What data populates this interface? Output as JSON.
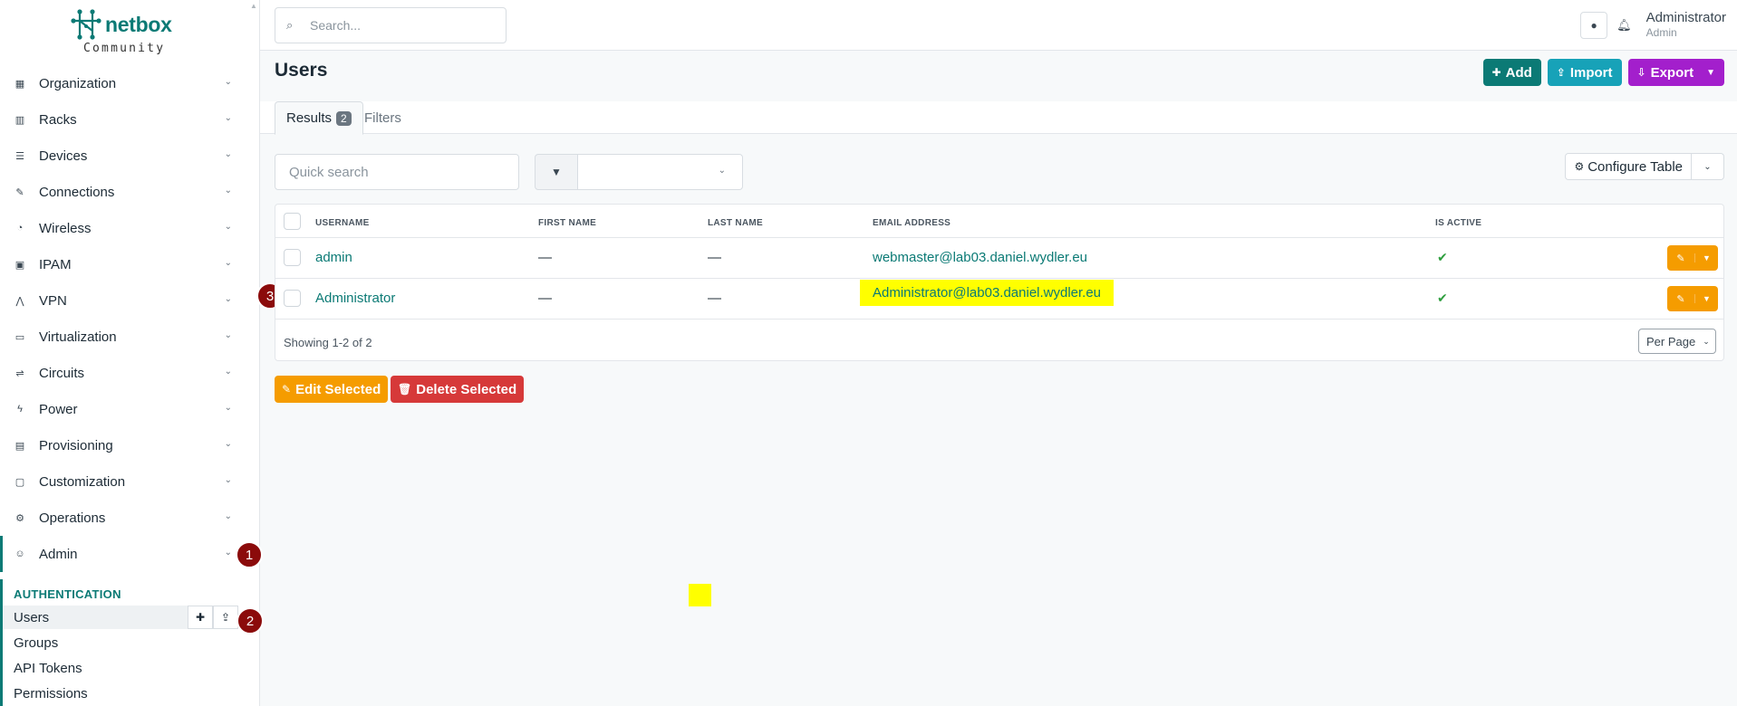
{
  "brand": {
    "name": "netbox",
    "edition": "Community"
  },
  "sidebar": {
    "menu": [
      {
        "label": "Organization",
        "icon": "building-icon",
        "glyph": "▦"
      },
      {
        "label": "Racks",
        "icon": "rack-icon",
        "glyph": "▥"
      },
      {
        "label": "Devices",
        "icon": "server-icon",
        "glyph": "☰"
      },
      {
        "label": "Connections",
        "icon": "plug-icon",
        "glyph": "✎"
      },
      {
        "label": "Wireless",
        "icon": "wifi-icon",
        "glyph": "◔"
      },
      {
        "label": "IPAM",
        "icon": "ipam-icon",
        "glyph": "▣"
      },
      {
        "label": "VPN",
        "icon": "vpn-icon",
        "glyph": "⋀"
      },
      {
        "label": "Virtualization",
        "icon": "monitor-icon",
        "glyph": "▭"
      },
      {
        "label": "Circuits",
        "icon": "circuit-icon",
        "glyph": "⇌"
      },
      {
        "label": "Power",
        "icon": "lightning-icon",
        "glyph": "ϟ"
      },
      {
        "label": "Provisioning",
        "icon": "document-icon",
        "glyph": "▤"
      },
      {
        "label": "Customization",
        "icon": "toolbox-icon",
        "glyph": "▢"
      },
      {
        "label": "Operations",
        "icon": "cogs-icon",
        "glyph": "⚙"
      },
      {
        "label": "Admin",
        "icon": "users-icon",
        "glyph": "☺"
      }
    ],
    "section_title": "AUTHENTICATION",
    "sub_items": [
      "Users",
      "Groups",
      "API Tokens",
      "Permissions"
    ]
  },
  "topbar": {
    "search_placeholder": "Search...",
    "user_name": "Administrator",
    "user_role": "Admin"
  },
  "page": {
    "title": "Users",
    "actions": {
      "add": "Add",
      "import": "Import",
      "export": "Export"
    },
    "tabs": {
      "results": "Results",
      "results_count": "2",
      "filters": "Filters"
    },
    "quick_search_placeholder": "Quick search",
    "configure_table": "Configure Table"
  },
  "table": {
    "columns": [
      "USERNAME",
      "FIRST NAME",
      "LAST NAME",
      "EMAIL ADDRESS",
      "IS ACTIVE"
    ],
    "rows": [
      {
        "username": "admin",
        "first_name": "—",
        "last_name": "—",
        "email": "webmaster@lab03.daniel.wydler.eu",
        "is_active": "✔"
      },
      {
        "username": "Administrator",
        "first_name": "—",
        "last_name": "—",
        "email": "Administrator@lab03.daniel.wydler.eu",
        "is_active": "✔"
      }
    ],
    "showing": "Showing 1-2 of 2",
    "per_page": "Per Page"
  },
  "bulk": {
    "edit": "Edit Selected",
    "delete": "Delete Selected"
  },
  "annotations": [
    "1",
    "2",
    "3"
  ],
  "colors": {
    "brand": "#0b7a75",
    "highlight": "#ffff00",
    "marker": "#8b0b0b"
  }
}
